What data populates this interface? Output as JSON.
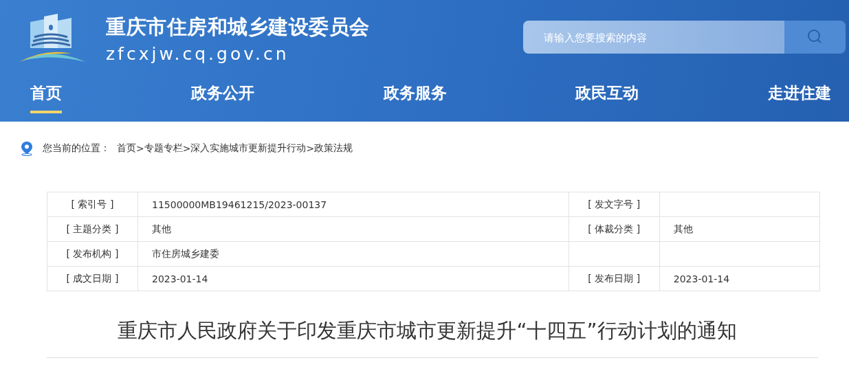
{
  "header": {
    "site_name": "重庆市住房和城乡建设委员会",
    "domain": "zfcxjw.cq.gov.cn"
  },
  "search": {
    "placeholder": "请输入您要搜索的内容"
  },
  "nav": [
    {
      "label": "首页",
      "selected": true
    },
    {
      "label": "政务公开",
      "selected": false
    },
    {
      "label": "政务服务",
      "selected": false
    },
    {
      "label": "政民互动",
      "selected": false
    },
    {
      "label": "走进住建",
      "selected": false
    }
  ],
  "breadcrumb": {
    "label": "您当前的位置：",
    "separator": ">",
    "items": [
      "首页",
      "专题专栏",
      "深入实施城市更新提升行动",
      "政策法规"
    ]
  },
  "info_table": [
    {
      "label_1": "[ 索引号 ]",
      "value_1": "11500000MB19461215/2023-00137",
      "label_2": "[ 发文字号 ]"
    },
    {
      "label_1": "[ 主题分类 ]",
      "value_1": "其他",
      "label_2": "[ 体裁分类 ]",
      "value_2": "其他"
    },
    {
      "label_1": "[ 发布机构 ]",
      "value_1": "市住房城乡建委"
    },
    {
      "label_1": "[ 成文日期 ]",
      "value_1": "2023-01-14",
      "label_2": "[ 发布日期 ]",
      "value_2": "2023-01-14"
    }
  ],
  "article": {
    "title": "重庆市人民政府关于印发重庆市城市更新提升“十四五”行动计划的通知"
  }
}
